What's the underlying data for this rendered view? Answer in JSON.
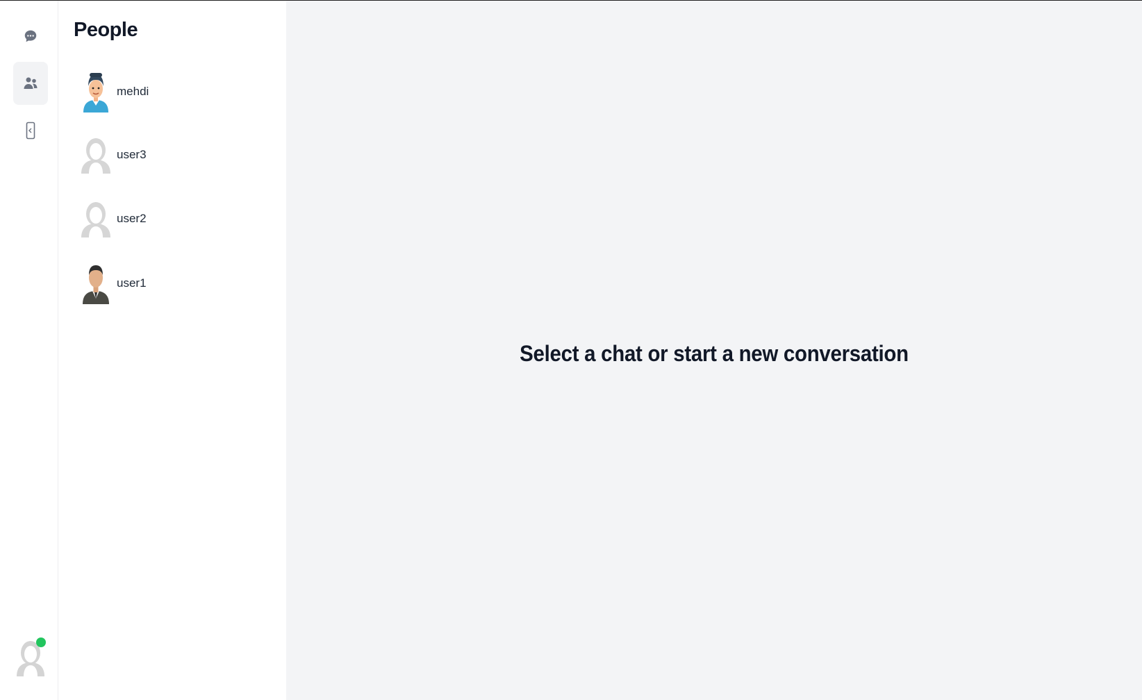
{
  "rail": {
    "items": [
      {
        "icon": "chat-bubble-icon",
        "label": "Chats",
        "active": false
      },
      {
        "icon": "people-icon",
        "label": "People",
        "active": true
      },
      {
        "icon": "logout-icon",
        "label": "Logout",
        "active": false
      }
    ],
    "current_user": {
      "status": "online",
      "status_color": "#22c55e"
    }
  },
  "people": {
    "title": "People",
    "list": [
      {
        "name": "mehdi",
        "avatar": "cartoon-man-avatar"
      },
      {
        "name": "user3",
        "avatar": "default-avatar"
      },
      {
        "name": "user2",
        "avatar": "default-avatar"
      },
      {
        "name": "user1",
        "avatar": "man-suit-avatar"
      }
    ]
  },
  "main": {
    "empty_message": "Select a chat or start a new conversation"
  },
  "colors": {
    "main_bg": "#f3f4f6",
    "active_rail_bg": "#f2f3f5",
    "text": "#111827",
    "online": "#22c55e"
  }
}
